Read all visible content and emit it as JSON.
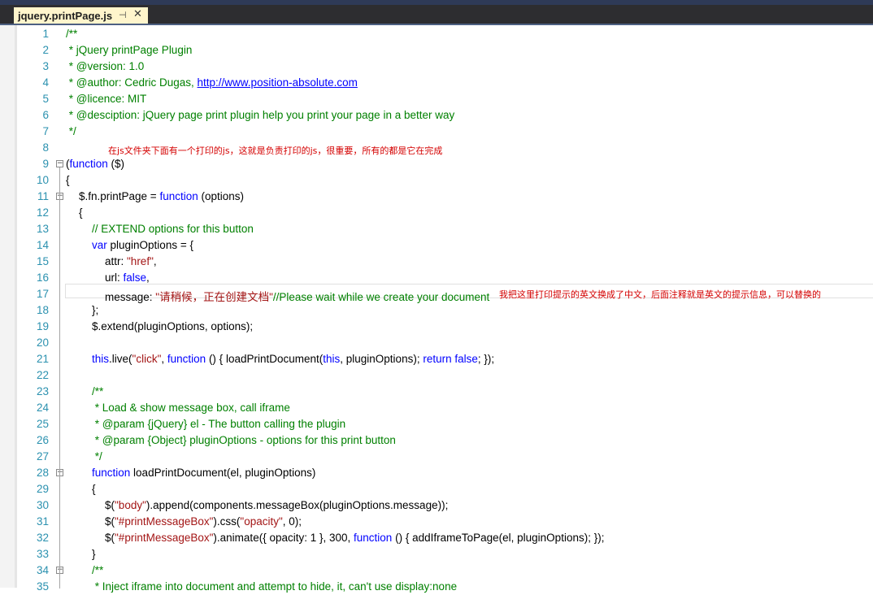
{
  "tab": {
    "title": "jquery.printPage.js",
    "pin_glyph": "⊣",
    "close_glyph": "✕"
  },
  "editor": {
    "fold_glyph": "−",
    "lines": [
      {
        "n": "1",
        "indent": 0,
        "fold": false,
        "tokens": [
          {
            "t": "/**",
            "c": "comment"
          }
        ]
      },
      {
        "n": "2",
        "indent": 0,
        "fold": false,
        "tokens": [
          {
            "t": " * jQuery printPage Plugin",
            "c": "comment"
          }
        ]
      },
      {
        "n": "3",
        "indent": 0,
        "fold": false,
        "tokens": [
          {
            "t": " * @version: 1.0",
            "c": "comment"
          }
        ]
      },
      {
        "n": "4",
        "indent": 0,
        "fold": false,
        "tokens": [
          {
            "t": " * @author: Cedric Dugas, ",
            "c": "comment"
          },
          {
            "t": "http://www.position-absolute.com",
            "c": "link"
          }
        ]
      },
      {
        "n": "5",
        "indent": 0,
        "fold": false,
        "tokens": [
          {
            "t": " * @licence: MIT",
            "c": "comment"
          }
        ]
      },
      {
        "n": "6",
        "indent": 0,
        "fold": false,
        "tokens": [
          {
            "t": " * @desciption: jQuery page print plugin help you print your page in a better way",
            "c": "comment"
          }
        ]
      },
      {
        "n": "7",
        "indent": 0,
        "fold": false,
        "tokens": [
          {
            "t": " */",
            "c": "comment"
          }
        ]
      },
      {
        "n": "8",
        "indent": 0,
        "fold": false,
        "tokens": []
      },
      {
        "n": "9",
        "indent": 0,
        "fold": true,
        "tokens": [
          {
            "t": "(",
            "c": "plain"
          },
          {
            "t": "function",
            "c": "keyword"
          },
          {
            "t": " ($)",
            "c": "plain"
          }
        ]
      },
      {
        "n": "10",
        "indent": 0,
        "fold": false,
        "tokens": [
          {
            "t": "{",
            "c": "plain"
          }
        ]
      },
      {
        "n": "11",
        "indent": 1,
        "fold": true,
        "tokens": [
          {
            "t": "$.fn.printPage = ",
            "c": "plain"
          },
          {
            "t": "function",
            "c": "keyword"
          },
          {
            "t": " (options)",
            "c": "plain"
          }
        ]
      },
      {
        "n": "12",
        "indent": 1,
        "fold": false,
        "tokens": [
          {
            "t": "{",
            "c": "plain"
          }
        ]
      },
      {
        "n": "13",
        "indent": 2,
        "fold": false,
        "tokens": [
          {
            "t": "// EXTEND options for this button",
            "c": "comment"
          }
        ]
      },
      {
        "n": "14",
        "indent": 2,
        "fold": false,
        "tokens": [
          {
            "t": "var",
            "c": "keyword"
          },
          {
            "t": " pluginOptions = {",
            "c": "plain"
          }
        ]
      },
      {
        "n": "15",
        "indent": 3,
        "fold": false,
        "tokens": [
          {
            "t": "attr: ",
            "c": "plain"
          },
          {
            "t": "\"href\"",
            "c": "string"
          },
          {
            "t": ",",
            "c": "plain"
          }
        ]
      },
      {
        "n": "16",
        "indent": 3,
        "fold": false,
        "tokens": [
          {
            "t": "url: ",
            "c": "plain"
          },
          {
            "t": "false",
            "c": "keyword"
          },
          {
            "t": ",",
            "c": "plain"
          }
        ]
      },
      {
        "n": "17",
        "indent": 3,
        "fold": false,
        "tokens": [
          {
            "t": "message: ",
            "c": "plain"
          },
          {
            "t": "\"请稍候，正在创建文档\"",
            "c": "string"
          },
          {
            "t": "//Please wait while we create your document",
            "c": "comment"
          }
        ]
      },
      {
        "n": "18",
        "indent": 2,
        "fold": false,
        "tokens": [
          {
            "t": "};",
            "c": "plain"
          }
        ]
      },
      {
        "n": "19",
        "indent": 2,
        "fold": false,
        "tokens": [
          {
            "t": "$.extend(pluginOptions, options);",
            "c": "plain"
          }
        ]
      },
      {
        "n": "20",
        "indent": 0,
        "fold": false,
        "tokens": []
      },
      {
        "n": "21",
        "indent": 2,
        "fold": false,
        "tokens": [
          {
            "t": "this",
            "c": "keyword"
          },
          {
            "t": ".live(",
            "c": "plain"
          },
          {
            "t": "\"click\"",
            "c": "string"
          },
          {
            "t": ", ",
            "c": "plain"
          },
          {
            "t": "function",
            "c": "keyword"
          },
          {
            "t": " () { loadPrintDocument(",
            "c": "plain"
          },
          {
            "t": "this",
            "c": "keyword"
          },
          {
            "t": ", pluginOptions); ",
            "c": "plain"
          },
          {
            "t": "return",
            "c": "keyword"
          },
          {
            "t": " ",
            "c": "plain"
          },
          {
            "t": "false",
            "c": "keyword"
          },
          {
            "t": "; });",
            "c": "plain"
          }
        ]
      },
      {
        "n": "22",
        "indent": 0,
        "fold": false,
        "tokens": []
      },
      {
        "n": "23",
        "indent": 2,
        "fold": false,
        "tokens": [
          {
            "t": "/**",
            "c": "comment"
          }
        ]
      },
      {
        "n": "24",
        "indent": 2,
        "fold": false,
        "tokens": [
          {
            "t": " * Load & show message box, call iframe",
            "c": "comment"
          }
        ]
      },
      {
        "n": "25",
        "indent": 2,
        "fold": false,
        "tokens": [
          {
            "t": " * @param {jQuery} el - The button calling the plugin",
            "c": "comment"
          }
        ]
      },
      {
        "n": "26",
        "indent": 2,
        "fold": false,
        "tokens": [
          {
            "t": " * @param {Object} pluginOptions - options for this print button",
            "c": "comment"
          }
        ]
      },
      {
        "n": "27",
        "indent": 2,
        "fold": false,
        "tokens": [
          {
            "t": " */",
            "c": "comment"
          }
        ]
      },
      {
        "n": "28",
        "indent": 2,
        "fold": true,
        "tokens": [
          {
            "t": "function",
            "c": "keyword"
          },
          {
            "t": " loadPrintDocument(el, pluginOptions)",
            "c": "plain"
          }
        ]
      },
      {
        "n": "29",
        "indent": 2,
        "fold": false,
        "tokens": [
          {
            "t": "{",
            "c": "plain"
          }
        ]
      },
      {
        "n": "30",
        "indent": 3,
        "fold": false,
        "tokens": [
          {
            "t": "$(",
            "c": "plain"
          },
          {
            "t": "\"body\"",
            "c": "string"
          },
          {
            "t": ").append(components.messageBox(pluginOptions.message));",
            "c": "plain"
          }
        ]
      },
      {
        "n": "31",
        "indent": 3,
        "fold": false,
        "tokens": [
          {
            "t": "$(",
            "c": "plain"
          },
          {
            "t": "\"#printMessageBox\"",
            "c": "string"
          },
          {
            "t": ").css(",
            "c": "plain"
          },
          {
            "t": "\"opacity\"",
            "c": "string"
          },
          {
            "t": ", 0);",
            "c": "plain"
          }
        ]
      },
      {
        "n": "32",
        "indent": 3,
        "fold": false,
        "tokens": [
          {
            "t": "$(",
            "c": "plain"
          },
          {
            "t": "\"#printMessageBox\"",
            "c": "string"
          },
          {
            "t": ").animate({ opacity: 1 }, 300, ",
            "c": "plain"
          },
          {
            "t": "function",
            "c": "keyword"
          },
          {
            "t": " () { addIframeToPage(el, pluginOptions); });",
            "c": "plain"
          }
        ]
      },
      {
        "n": "33",
        "indent": 2,
        "fold": false,
        "tokens": [
          {
            "t": "}",
            "c": "plain"
          }
        ]
      },
      {
        "n": "34",
        "indent": 2,
        "fold": true,
        "tokens": [
          {
            "t": "/**",
            "c": "comment"
          }
        ]
      },
      {
        "n": "35",
        "indent": 2,
        "fold": false,
        "tokens": [
          {
            "t": " * Inject iframe into document and attempt to hide, it, can't use display:none",
            "c": "comment"
          }
        ]
      }
    ],
    "annotations": [
      {
        "line": "8",
        "text": "在js文件夹下面有一个打印的js，这就是负责打印的js，很重要，所有的都是它在完成"
      },
      {
        "line": "17",
        "text": "我把这里打印提示的英文换成了中文，后面注释就是英文的提示信息，可以替换的"
      }
    ]
  },
  "colors": {
    "comment": "#008000",
    "keyword": "#0000ff",
    "string": "#a31515",
    "line_number": "#2b91af",
    "annotation": "#d40000",
    "tab_active": "#fff5cc"
  }
}
